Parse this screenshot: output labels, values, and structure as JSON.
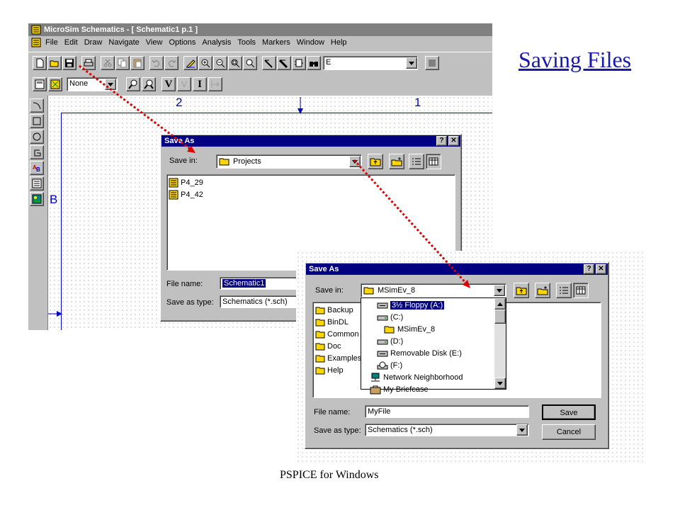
{
  "slide": {
    "title": "Saving Files",
    "footer": "PSPICE for Windows"
  },
  "app": {
    "title": "MicroSim Schematics - [ Schematic1  p.1   ]",
    "menu": [
      "File",
      "Edit",
      "Draw",
      "Navigate",
      "View",
      "Options",
      "Analysis",
      "Tools",
      "Markers",
      "Window",
      "Help"
    ],
    "part_box": "E",
    "style_box": "None",
    "page_labels": {
      "col2": "2",
      "col1": "1",
      "rowB": "B"
    }
  },
  "dialog1": {
    "title": "Save As",
    "help_btn": "?",
    "close_btn": "✕",
    "save_in_label": "Save in:",
    "save_in_value": "Projects",
    "files": [
      "P4_29",
      "P4_42"
    ],
    "file_name_label": "File name:",
    "file_name_value": "Schematic1",
    "save_type_label": "Save as type:",
    "save_type_value": "Schematics (*.sch)"
  },
  "dialog2": {
    "title": "Save As",
    "help_btn": "?",
    "close_btn": "✕",
    "save_in_label": "Save in:",
    "save_in_value": "MSimEv_8",
    "folders": [
      "Backup",
      "BinDL",
      "Common",
      "Doc",
      "Examples",
      "Help"
    ],
    "dropdown_items": [
      {
        "label": "3½ Floppy (A:)",
        "icon": "floppy-drive-icon",
        "indent": 0,
        "selected": true
      },
      {
        "label": "(C:)",
        "icon": "hard-drive-icon",
        "indent": 0,
        "selected": false
      },
      {
        "label": "MSimEv_8",
        "icon": "open-folder-icon",
        "indent": 1,
        "selected": false
      },
      {
        "label": "(D:)",
        "icon": "hard-drive-icon",
        "indent": 0,
        "selected": false
      },
      {
        "label": "Removable Disk (E:)",
        "icon": "removable-disk-icon",
        "indent": 0,
        "selected": false
      },
      {
        "label": "(F:)",
        "icon": "cd-drive-icon",
        "indent": 0,
        "selected": false
      },
      {
        "label": "Network Neighborhood",
        "icon": "network-icon",
        "indent": -1,
        "selected": false
      },
      {
        "label": "My Briefcase",
        "icon": "briefcase-icon",
        "indent": -1,
        "selected": false
      }
    ],
    "file_name_label": "File name:",
    "file_name_value": "MyFile",
    "save_type_label": "Save as type:",
    "save_type_value": "Schematics (*.sch)",
    "save_button": "Save",
    "cancel_button": "Cancel"
  },
  "colors": {
    "titlebar_active": "#000080",
    "face": "#c0c0c0",
    "arrow": "#e00000",
    "link": "#1a1aa8"
  }
}
